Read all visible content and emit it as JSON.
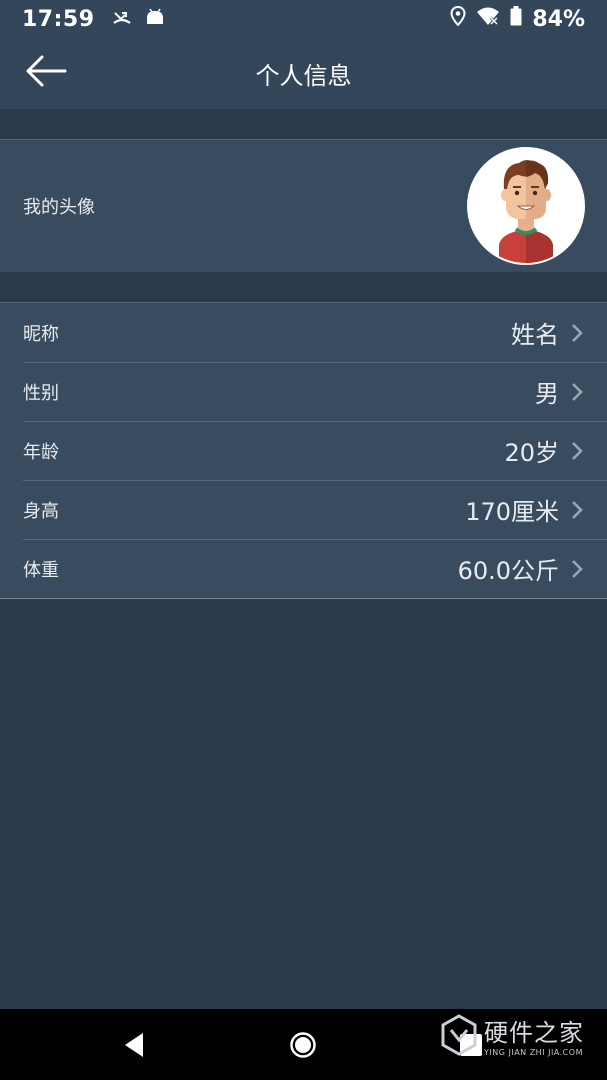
{
  "status_bar": {
    "time": "17:59",
    "left_icons": [
      "missed-call-icon",
      "android-icon"
    ],
    "right_icons": [
      "location-icon",
      "wifi-icon",
      "battery-icon"
    ],
    "battery_percent": "84%"
  },
  "app_bar": {
    "title": "个人信息",
    "back_icon": "arrow-left-icon"
  },
  "avatar_section": {
    "label": "我的头像",
    "avatar_icon": "male-avatar-icon"
  },
  "profile": {
    "items": [
      {
        "label": "昵称",
        "value": "姓名"
      },
      {
        "label": "性别",
        "value": "男"
      },
      {
        "label": "年龄",
        "value": "20岁"
      },
      {
        "label": "身高",
        "value": "170厘米"
      },
      {
        "label": "体重",
        "value": "60.0公斤"
      }
    ]
  },
  "nav_bar": {
    "buttons": [
      "back-triangle-icon",
      "home-circle-icon",
      "recent-square-icon"
    ]
  },
  "watermark": {
    "name": "硬件之家",
    "sub": "YING JIAN ZHI JIA.COM"
  },
  "colors": {
    "app_bar_bg": "#34475a",
    "page_bg": "#2b3a4a",
    "row_bg": "#394b5e",
    "divider": "#56687a",
    "text": "#e6ebf0"
  }
}
